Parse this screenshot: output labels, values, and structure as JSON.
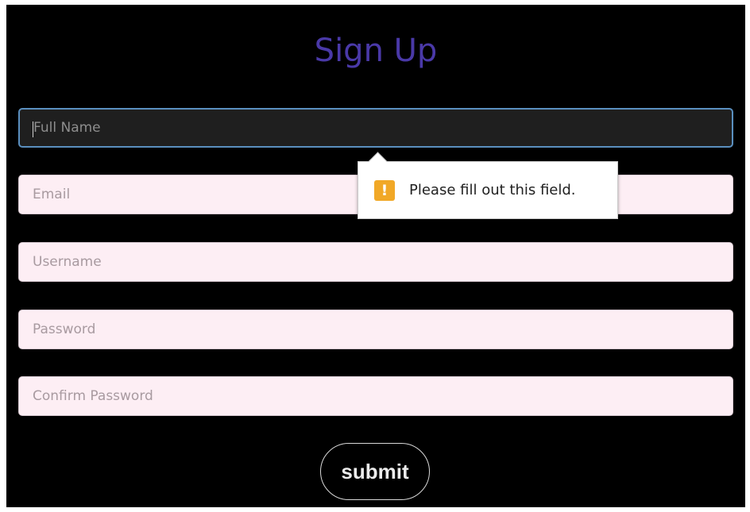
{
  "form": {
    "title": "Sign Up",
    "fields": [
      {
        "placeholder": "Full Name",
        "value": ""
      },
      {
        "placeholder": "Email",
        "value": ""
      },
      {
        "placeholder": "Username",
        "value": ""
      },
      {
        "placeholder": "Password",
        "value": ""
      },
      {
        "placeholder": "Confirm Password",
        "value": ""
      }
    ],
    "submit_label": "submit"
  },
  "validation": {
    "message": "Please fill out this field.",
    "icon": "warning-icon",
    "icon_glyph": "!"
  },
  "colors": {
    "background": "#000000",
    "title": "#4a39a8",
    "field_bg": "#fdeef4",
    "focused_field_bg": "#1f1f1f",
    "focus_border": "#5a8fbf",
    "warning": "#f1a827"
  }
}
